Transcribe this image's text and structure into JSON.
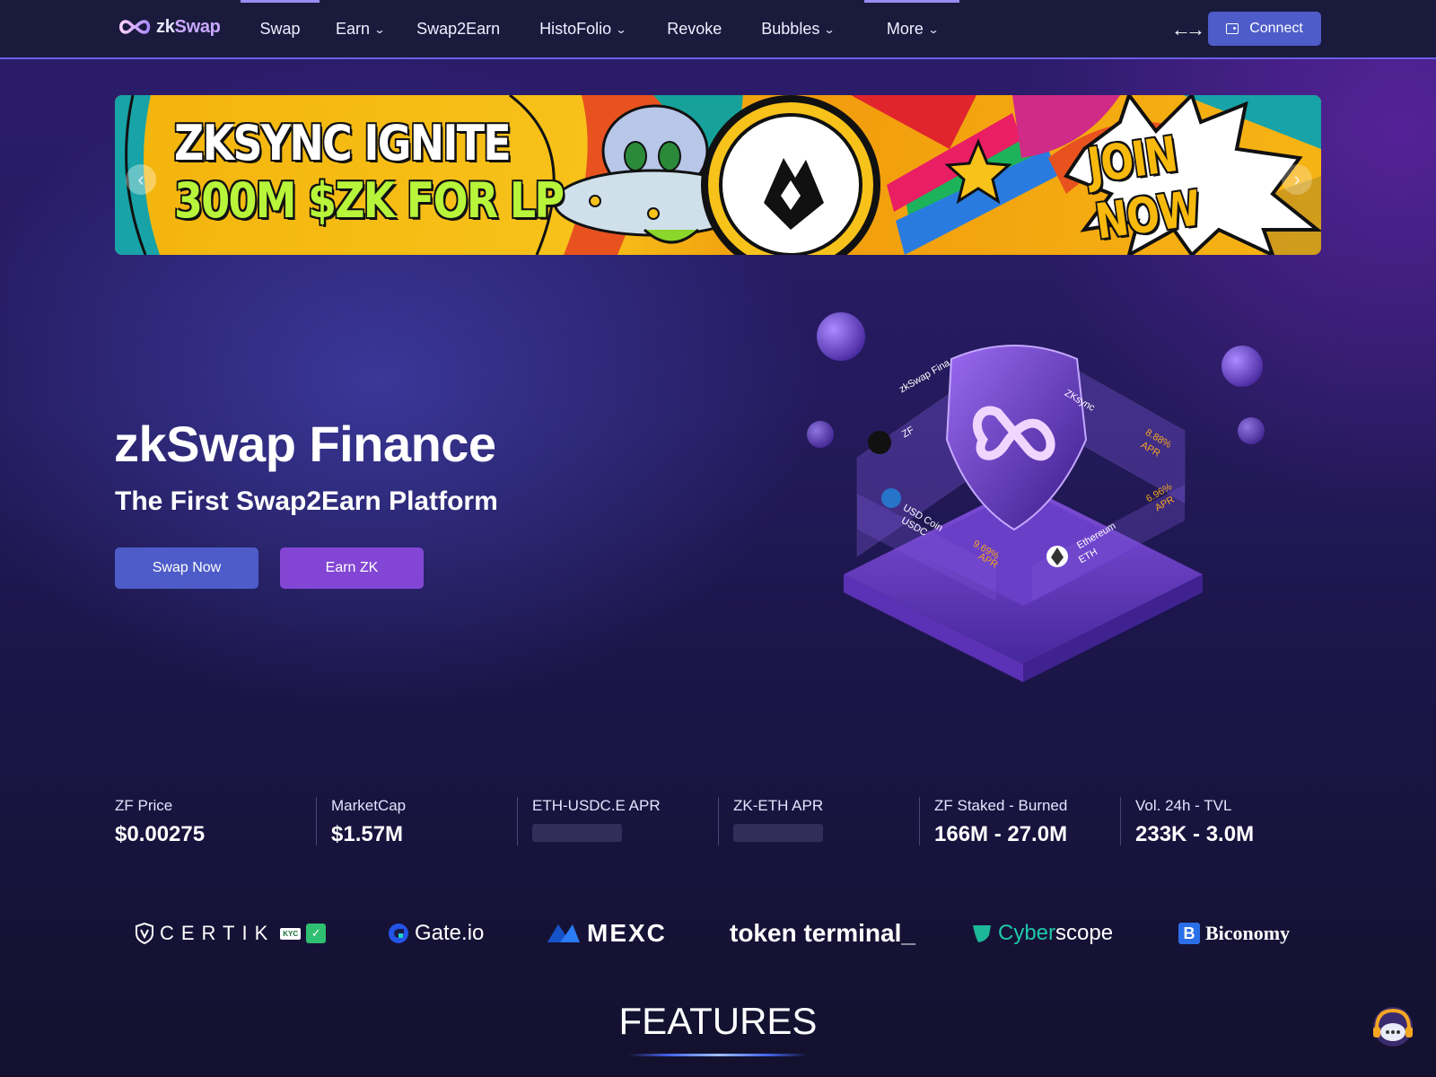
{
  "nav": {
    "logo_zk": "zk",
    "logo_swap": "Swap",
    "items": [
      {
        "label": "Swap",
        "dropdown": false
      },
      {
        "label": "Earn",
        "dropdown": true
      },
      {
        "label": "Swap2Earn",
        "dropdown": false
      },
      {
        "label": "HistoFolio",
        "dropdown": true
      },
      {
        "label": "Revoke",
        "dropdown": false
      },
      {
        "label": "Bubbles",
        "dropdown": true
      },
      {
        "label": "More",
        "dropdown": true
      }
    ],
    "connect_label": "Connect"
  },
  "banner": {
    "line1": "ZKSYNC IGNITE",
    "line2": "300M $ZK FOR LP",
    "cta": "JOIN NOW"
  },
  "hero": {
    "title": "zkSwap Finance",
    "subtitle": "The First Swap2Earn Platform",
    "swap_button": "Swap Now",
    "earn_button": "Earn ZK"
  },
  "illustration": {
    "card_zf_name": "zkSwap Fina",
    "card_zf_symbol": "ZF",
    "card_zksync": "ZKsync",
    "apr_1": "8.88%",
    "apr_2": "6.96%",
    "apr_3": "9.69%",
    "apr_word": "APR",
    "usdc_name": "USD Coin",
    "usdc_symbol": "USDC",
    "eth_name": "Ethereum",
    "eth_symbol": "ETH"
  },
  "stats": [
    {
      "label": "ZF Price",
      "value": "$0.00275",
      "loading": false
    },
    {
      "label": "MarketCap",
      "value": "$1.57M",
      "loading": false
    },
    {
      "label": "ETH-USDC.E APR",
      "value": "",
      "loading": true
    },
    {
      "label": "ZK-ETH APR",
      "value": "",
      "loading": true
    },
    {
      "label": "ZF Staked - Burned",
      "value": "166M - 27.0M",
      "loading": false
    },
    {
      "label": "Vol. 24h - TVL",
      "value": "233K - 3.0M",
      "loading": false
    }
  ],
  "partners": {
    "certik": "CERTIK",
    "certik_badge": "KYC",
    "gate": "Gate.io",
    "mexc": "MEXC",
    "token_terminal": "token terminal_",
    "cyberscope_a": "Cyber",
    "cyberscope_b": "scope",
    "biconomy": "Biconomy"
  },
  "features_title": "FEATURES",
  "colors": {
    "accent_blue": "#4d5cc8",
    "accent_purple": "#8346d4",
    "nav_bg": "#1a1a3d"
  }
}
